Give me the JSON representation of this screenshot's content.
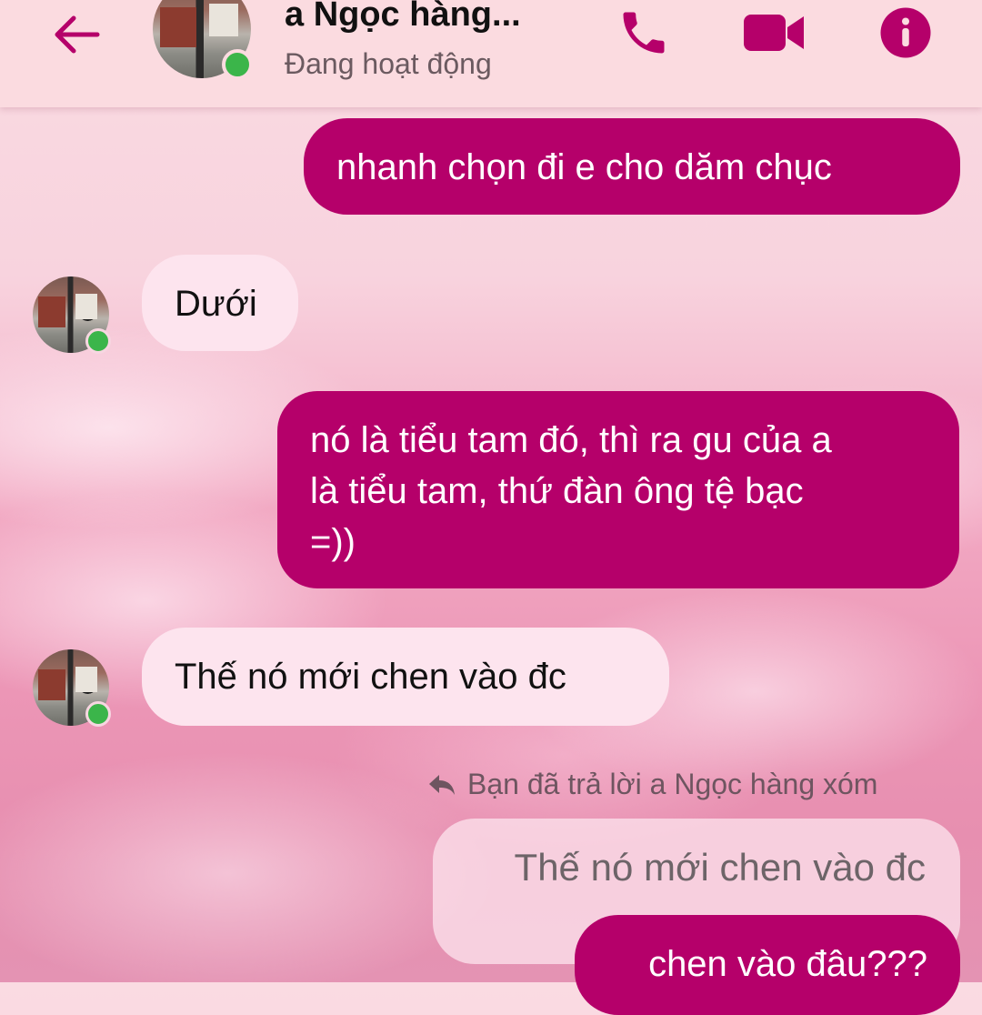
{
  "header": {
    "contact_name": "a Ngọc hàng...",
    "status": "Đang hoạt động",
    "back_icon": "arrow-left-icon",
    "call_icon": "phone-icon",
    "video_icon": "video-camera-icon",
    "info_icon": "info-icon",
    "accent_color": "#b5006a",
    "online_color": "#3bb54a"
  },
  "messages": [
    {
      "from": "me",
      "text": "nhanh chọn đi e cho dăm chục"
    },
    {
      "from": "contact",
      "text": "Dưới"
    },
    {
      "from": "me",
      "lines": [
        "nó là tiểu tam đó, thì ra gu của a",
        "là tiểu tam, thứ đàn ông tệ bạc",
        "=))"
      ]
    },
    {
      "from": "contact",
      "text": "Thế nó mới chen vào đc"
    },
    {
      "from": "me",
      "reply_note": "Bạn đã trả lời a Ngọc hàng xóm",
      "quoted_text": "Thế nó mới chen vào đc",
      "text": "chen vào đâu???"
    }
  ]
}
